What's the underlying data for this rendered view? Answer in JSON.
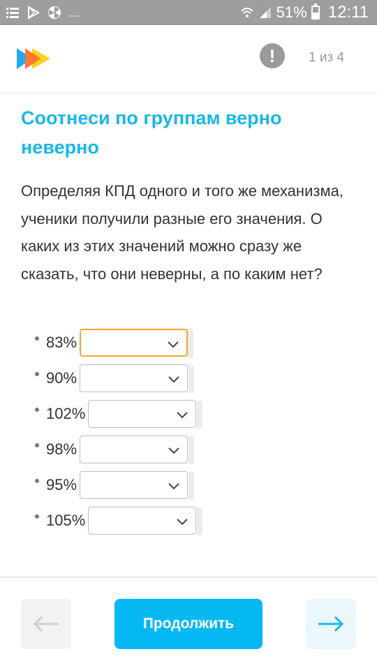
{
  "status_bar": {
    "icons_left": [
      "notification-list-icon",
      "play-store-icon",
      "radiation-icon"
    ],
    "overflow": "...",
    "battery_percent": "51%",
    "time": "12:11",
    "icons_right": [
      "wifi-icon",
      "signal-icon",
      "battery-icon"
    ]
  },
  "header": {
    "progress_label": "1 из 4",
    "report_icon": "exclamation-icon",
    "colors": {
      "logo_blue": "#21a9f3",
      "logo_orange": "#ff7a2f",
      "logo_yellow": "#ffd21f"
    }
  },
  "task": {
    "title": "Соотнеси по группам верно неверно",
    "question": "Определяя КПД одного и того же механизма, ученики получили разные его значения. О каких из этих значений можно сразу же сказать, что они неверны, а по каким нет?"
  },
  "answers": [
    {
      "label": "83%",
      "value": "",
      "focused": true
    },
    {
      "label": "90%",
      "value": "",
      "focused": false
    },
    {
      "label": "102%",
      "value": "",
      "focused": false
    },
    {
      "label": "98%",
      "value": "",
      "focused": false
    },
    {
      "label": "95%",
      "value": "",
      "focused": false
    },
    {
      "label": "105%",
      "value": "",
      "focused": false
    }
  ],
  "footer": {
    "continue_label": "Продолжить",
    "back_icon": "arrow-left-icon",
    "next_icon": "arrow-right-icon",
    "colors": {
      "accent": "#05b8f2",
      "title": "#19b7e8",
      "focus": "#f0a830"
    }
  }
}
